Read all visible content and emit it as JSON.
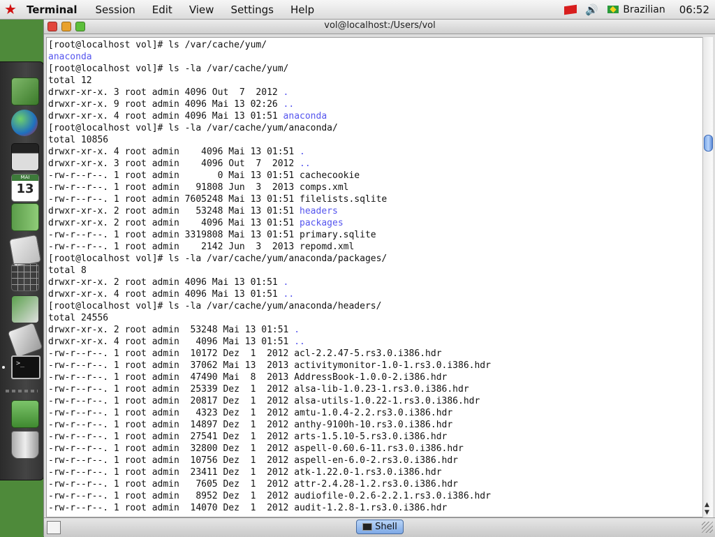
{
  "menubar": {
    "app_name": "Terminal",
    "items": [
      "Session",
      "Edit",
      "View",
      "Settings",
      "Help"
    ],
    "language": "Brazilian",
    "clock": "06:52"
  },
  "dock": {
    "calendar_month": "MAI",
    "calendar_day": "13"
  },
  "window": {
    "title": "vol@localhost:/Users/vol"
  },
  "terminal": {
    "lines": [
      [
        {
          "t": "[root@localhost vol]# ls /var/cache/yum/"
        }
      ],
      [
        {
          "t": "anaconda",
          "c": "dir"
        }
      ],
      [
        {
          "t": "[root@localhost vol]# ls -la /var/cache/yum/"
        }
      ],
      [
        {
          "t": "total 12"
        }
      ],
      [
        {
          "t": "drwxr-xr-x. 3 root admin 4096 Out  7  2012 "
        },
        {
          "t": ".",
          "c": "dir"
        }
      ],
      [
        {
          "t": "drwxr-xr-x. 9 root admin 4096 Mai 13 02:26 "
        },
        {
          "t": "..",
          "c": "dir"
        }
      ],
      [
        {
          "t": "drwxr-xr-x. 4 root admin 4096 Mai 13 01:51 "
        },
        {
          "t": "anaconda",
          "c": "dir"
        }
      ],
      [
        {
          "t": "[root@localhost vol]# ls -la /var/cache/yum/anaconda/"
        }
      ],
      [
        {
          "t": "total 10856"
        }
      ],
      [
        {
          "t": "drwxr-xr-x. 4 root admin    4096 Mai 13 01:51 "
        },
        {
          "t": ".",
          "c": "dir"
        }
      ],
      [
        {
          "t": "drwxr-xr-x. 3 root admin    4096 Out  7  2012 "
        },
        {
          "t": "..",
          "c": "dir"
        }
      ],
      [
        {
          "t": "-rw-r--r--. 1 root admin       0 Mai 13 01:51 cachecookie"
        }
      ],
      [
        {
          "t": "-rw-r--r--. 1 root admin   91808 Jun  3  2013 comps.xml"
        }
      ],
      [
        {
          "t": "-rw-r--r--. 1 root admin 7605248 Mai 13 01:51 filelists.sqlite"
        }
      ],
      [
        {
          "t": "drwxr-xr-x. 2 root admin   53248 Mai 13 01:51 "
        },
        {
          "t": "headers",
          "c": "dir"
        }
      ],
      [
        {
          "t": "drwxr-xr-x. 2 root admin    4096 Mai 13 01:51 "
        },
        {
          "t": "packages",
          "c": "dir"
        }
      ],
      [
        {
          "t": "-rw-r--r--. 1 root admin 3319808 Mai 13 01:51 primary.sqlite"
        }
      ],
      [
        {
          "t": "-rw-r--r--. 1 root admin    2142 Jun  3  2013 repomd.xml"
        }
      ],
      [
        {
          "t": "[root@localhost vol]# ls -la /var/cache/yum/anaconda/packages/"
        }
      ],
      [
        {
          "t": "total 8"
        }
      ],
      [
        {
          "t": "drwxr-xr-x. 2 root admin 4096 Mai 13 01:51 "
        },
        {
          "t": ".",
          "c": "dir"
        }
      ],
      [
        {
          "t": "drwxr-xr-x. 4 root admin 4096 Mai 13 01:51 "
        },
        {
          "t": "..",
          "c": "dir"
        }
      ],
      [
        {
          "t": "[root@localhost vol]# ls -la /var/cache/yum/anaconda/headers/"
        }
      ],
      [
        {
          "t": "total 24556"
        }
      ],
      [
        {
          "t": "drwxr-xr-x. 2 root admin  53248 Mai 13 01:51 "
        },
        {
          "t": ".",
          "c": "dir"
        }
      ],
      [
        {
          "t": "drwxr-xr-x. 4 root admin   4096 Mai 13 01:51 "
        },
        {
          "t": "..",
          "c": "dir"
        }
      ],
      [
        {
          "t": "-rw-r--r--. 1 root admin  10172 Dez  1  2012 acl-2.2.47-5.rs3.0.i386.hdr"
        }
      ],
      [
        {
          "t": "-rw-r--r--. 1 root admin  37062 Mai 13  2013 activitymonitor-1.0-1.rs3.0.i386.hdr"
        }
      ],
      [
        {
          "t": "-rw-r--r--. 1 root admin  47490 Mai  8  2013 AddressBook-1.0.0-2.i386.hdr"
        }
      ],
      [
        {
          "t": "-rw-r--r--. 1 root admin  25339 Dez  1  2012 alsa-lib-1.0.23-1.rs3.0.i386.hdr"
        }
      ],
      [
        {
          "t": "-rw-r--r--. 1 root admin  20817 Dez  1  2012 alsa-utils-1.0.22-1.rs3.0.i386.hdr"
        }
      ],
      [
        {
          "t": "-rw-r--r--. 1 root admin   4323 Dez  1  2012 amtu-1.0.4-2.2.rs3.0.i386.hdr"
        }
      ],
      [
        {
          "t": "-rw-r--r--. 1 root admin  14897 Dez  1  2012 anthy-9100h-10.rs3.0.i386.hdr"
        }
      ],
      [
        {
          "t": "-rw-r--r--. 1 root admin  27541 Dez  1  2012 arts-1.5.10-5.rs3.0.i386.hdr"
        }
      ],
      [
        {
          "t": "-rw-r--r--. 1 root admin  32800 Dez  1  2012 aspell-0.60.6-11.rs3.0.i386.hdr"
        }
      ],
      [
        {
          "t": "-rw-r--r--. 1 root admin  10756 Dez  1  2012 aspell-en-6.0-2.rs3.0.i386.hdr"
        }
      ],
      [
        {
          "t": "-rw-r--r--. 1 root admin  23411 Dez  1  2012 atk-1.22.0-1.rs3.0.i386.hdr"
        }
      ],
      [
        {
          "t": "-rw-r--r--. 1 root admin   7605 Dez  1  2012 attr-2.4.28-1.2.rs3.0.i386.hdr"
        }
      ],
      [
        {
          "t": "-rw-r--r--. 1 root admin   8952 Dez  1  2012 audiofile-0.2.6-2.2.1.rs3.0.i386.hdr"
        }
      ],
      [
        {
          "t": "-rw-r--r--. 1 root admin  14070 Dez  1  2012 audit-1.2.8-1.rs3.0.i386.hdr"
        }
      ]
    ]
  },
  "tabs": {
    "active_label": "Shell"
  }
}
